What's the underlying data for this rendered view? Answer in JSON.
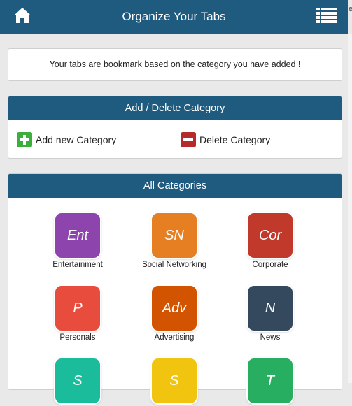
{
  "header": {
    "title": "Organize Your Tabs",
    "home_icon": "home-icon",
    "menu_icon": "list-menu-icon"
  },
  "edge_mark": "e",
  "info": {
    "message": "Your tabs are bookmark based on the category you have added !"
  },
  "category_panel": {
    "title": "Add / Delete Category",
    "add_label": "Add new Category",
    "delete_label": "Delete Category"
  },
  "all_categories": {
    "title": "All Categories",
    "items": [
      {
        "abbr": "Ent",
        "label": "Entertainment",
        "color": "#8e44ad"
      },
      {
        "abbr": "SN",
        "label": "Social Networking",
        "color": "#e67e22"
      },
      {
        "abbr": "Cor",
        "label": "Corporate",
        "color": "#c0392b"
      },
      {
        "abbr": "P",
        "label": "Personals",
        "color": "#e74c3c"
      },
      {
        "abbr": "Adv",
        "label": "Advertising",
        "color": "#d35400"
      },
      {
        "abbr": "N",
        "label": "News",
        "color": "#34495e"
      },
      {
        "abbr": "S",
        "label": "",
        "color": "#1abc9c"
      },
      {
        "abbr": "S",
        "label": "",
        "color": "#f1c40f"
      },
      {
        "abbr": "T",
        "label": "",
        "color": "#27ae60"
      }
    ]
  },
  "colors": {
    "header_bg": "#1e5b7f",
    "page_bg": "#e9e9e9",
    "add_green": "#3cae3c",
    "delete_red": "#b52a2a"
  }
}
